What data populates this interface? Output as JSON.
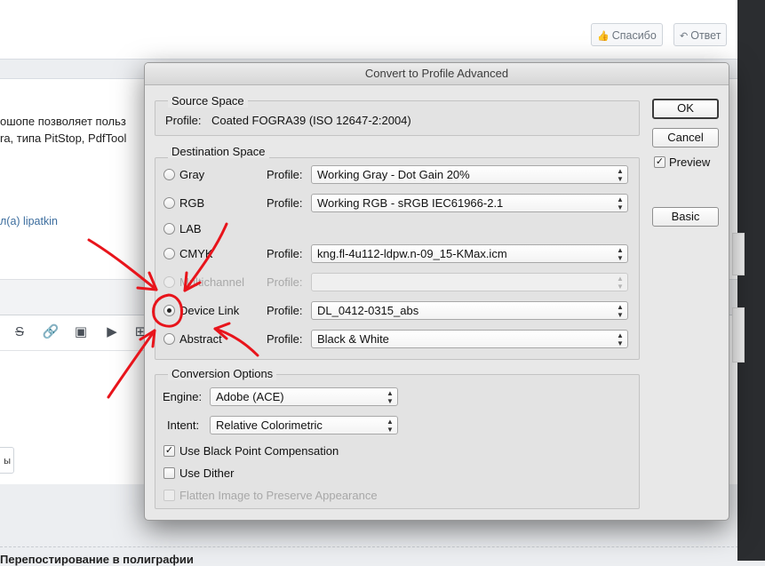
{
  "background": {
    "thanks_button": "Спасибо",
    "reply_button": "Ответ",
    "text_line1": "ошопе позволяет польз",
    "text_line2": "ra, типа PitStop, PdfTool",
    "author_link": "л(а) lipatkin",
    "small_button": "ы",
    "footer_text": "Перепостирование в полиграфии"
  },
  "dialog": {
    "title": "Convert to Profile Advanced",
    "source": {
      "title": "Source Space",
      "profile_label": "Profile:",
      "profile_value": "Coated FOGRA39 (ISO 12647-2:2004)"
    },
    "destination": {
      "title": "Destination Space",
      "profile_label": "Profile:",
      "options": [
        {
          "label": "Gray",
          "profile": "Working Gray - Dot Gain 20%"
        },
        {
          "label": "RGB",
          "profile": "Working RGB - sRGB IEC61966-2.1"
        },
        {
          "label": "LAB"
        },
        {
          "label": "CMYK",
          "profile": "kng.fl-4u112-ldpw.n-09_15-KMax.icm"
        },
        {
          "label": "Multichannel",
          "profile": "",
          "disabled": true
        },
        {
          "label": "Device Link",
          "profile": "DL_0412-0315_abs",
          "selected": true
        },
        {
          "label": "Abstract",
          "profile": "Black & White"
        }
      ]
    },
    "conversion": {
      "title": "Conversion Options",
      "engine_label": "Engine:",
      "engine_value": "Adobe (ACE)",
      "intent_label": "Intent:",
      "intent_value": "Relative Colorimetric",
      "black_point": {
        "label": "Use Black Point Compensation",
        "checked": true
      },
      "dither": {
        "label": "Use Dither",
        "checked": false
      },
      "flatten": {
        "label": "Flatten Image to Preserve Appearance",
        "checked": false,
        "disabled": true
      }
    },
    "buttons": {
      "ok": "OK",
      "cancel": "Cancel",
      "preview": "Preview",
      "preview_checked": true,
      "basic": "Basic"
    }
  },
  "colors": {
    "annotation": "#e8141b",
    "dialog_bg": "#e8e8e8"
  }
}
